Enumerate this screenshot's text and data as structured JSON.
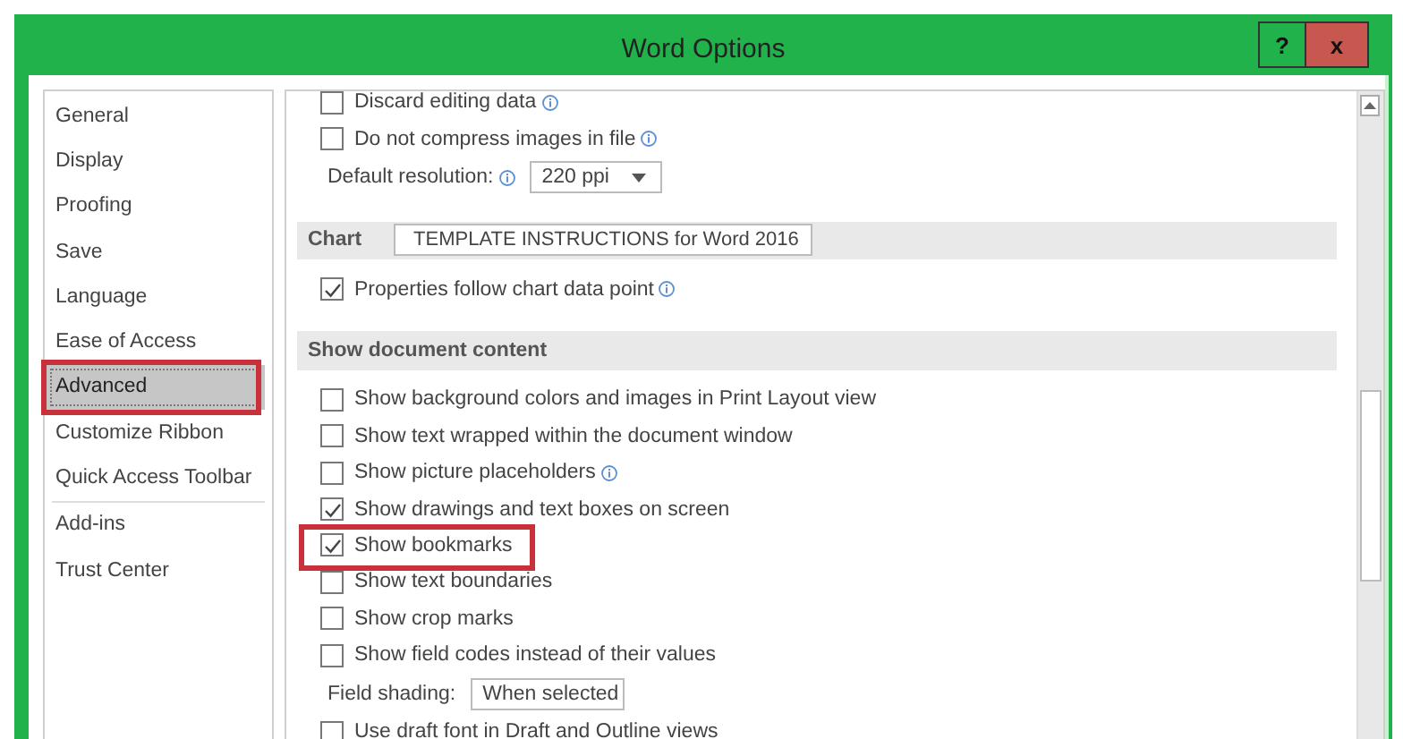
{
  "window": {
    "title": "Word Options",
    "buttons": [
      {
        "kind": "help",
        "label": "?"
      },
      {
        "kind": "close",
        "label": "x"
      }
    ]
  },
  "sidebar": {
    "groups": [
      {
        "items": [
          {
            "label": "General",
            "selected": false,
            "highlighted": false
          },
          {
            "label": "Display",
            "selected": false,
            "highlighted": false
          },
          {
            "label": "Proofing",
            "selected": false,
            "highlighted": false
          },
          {
            "label": "Save",
            "selected": false,
            "highlighted": false
          },
          {
            "label": "Language",
            "selected": false,
            "highlighted": false
          },
          {
            "label": "Ease of Access",
            "selected": false,
            "highlighted": false
          },
          {
            "label": "Advanced",
            "selected": true,
            "highlighted": true
          },
          {
            "label": "Customize Ribbon",
            "selected": false,
            "highlighted": false
          },
          {
            "label": "Quick Access Toolbar",
            "selected": false,
            "highlighted": false
          }
        ]
      },
      {
        "items": [
          {
            "label": "Add-ins",
            "selected": false,
            "highlighted": false
          },
          {
            "label": "Trust Center",
            "selected": false,
            "highlighted": false
          }
        ]
      }
    ]
  },
  "content": {
    "items": [
      {
        "kind": "checkbox",
        "label": "Discard editing data",
        "checked": false,
        "info": true,
        "highlighted": false
      },
      {
        "kind": "checkbox",
        "label": "Do not compress images in file",
        "checked": false,
        "info": true,
        "highlighted": false
      },
      {
        "kind": "select",
        "label": "Default resolution:",
        "value": "220 ppi",
        "info": true
      },
      {
        "kind": "header",
        "label": "Chart",
        "value": "TEMPLATE INSTRUCTIONS for Word 2016"
      },
      {
        "kind": "checkbox",
        "label": "Properties follow chart data point",
        "checked": true,
        "info": true,
        "highlighted": false
      },
      {
        "kind": "header",
        "label": "Show document content"
      },
      {
        "kind": "checkbox",
        "label": "Show background colors and images in Print Layout view",
        "checked": false,
        "info": false,
        "highlighted": false
      },
      {
        "kind": "checkbox",
        "label": "Show text wrapped within the document window",
        "checked": false,
        "info": false,
        "highlighted": false
      },
      {
        "kind": "checkbox",
        "label": "Show picture placeholders",
        "checked": false,
        "info": true,
        "highlighted": false
      },
      {
        "kind": "checkbox",
        "label": "Show drawings and text boxes on screen",
        "checked": true,
        "info": false,
        "highlighted": false
      },
      {
        "kind": "checkbox",
        "label": "Show bookmarks",
        "checked": true,
        "info": false,
        "highlighted": true
      },
      {
        "kind": "checkbox",
        "label": "Show text boundaries",
        "checked": false,
        "info": false,
        "highlighted": false
      },
      {
        "kind": "checkbox",
        "label": "Show crop marks",
        "checked": false,
        "info": false,
        "highlighted": false
      },
      {
        "kind": "checkbox",
        "label": "Show field codes instead of their values",
        "checked": false,
        "info": false,
        "highlighted": false
      },
      {
        "kind": "select",
        "label": "Field shading:",
        "value": "When selected",
        "info": false
      },
      {
        "kind": "checkbox",
        "label": "Use draft font in Draft and Outline views",
        "checked": false,
        "info": false,
        "highlighted": false
      }
    ]
  }
}
